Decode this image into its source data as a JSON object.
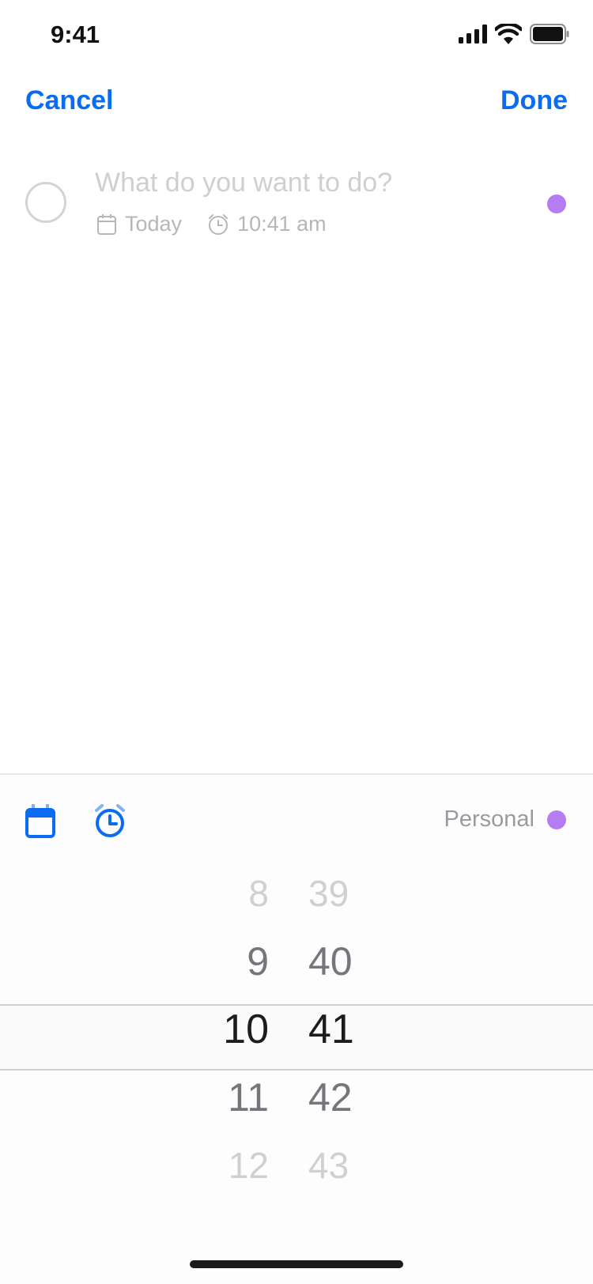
{
  "status_bar": {
    "time": "9:41"
  },
  "nav": {
    "cancel_label": "Cancel",
    "done_label": "Done"
  },
  "task": {
    "placeholder": "What do you want to do?",
    "date_label": "Today",
    "time_label": "10:41 am",
    "list_color": "#b57cf3"
  },
  "toolbar": {
    "list_label": "Personal",
    "list_color": "#b57cf3",
    "accent": "#0a6cf0",
    "icons": [
      "calendar-icon",
      "alarm-clock-icon"
    ]
  },
  "picker": {
    "hours": [
      "8",
      "9",
      "10",
      "11",
      "12"
    ],
    "minutes": [
      "39",
      "40",
      "41",
      "42",
      "43"
    ],
    "selected_hour": "10",
    "selected_minute": "41"
  }
}
